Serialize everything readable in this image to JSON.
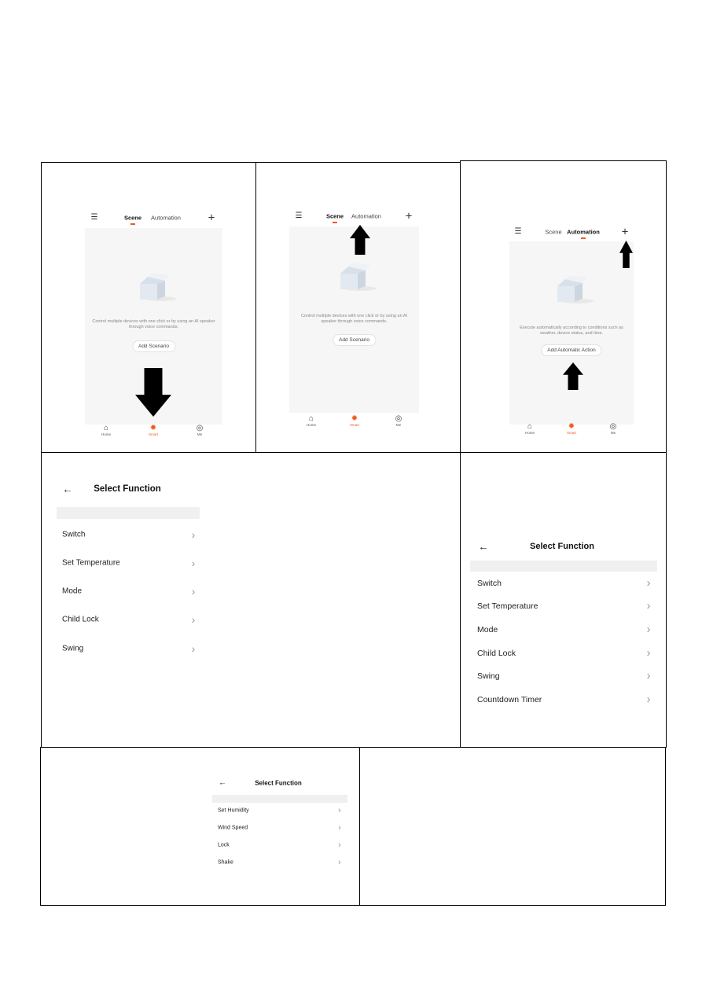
{
  "phones": [
    {
      "nav": {
        "menu_icon": "hamburger-icon",
        "tabs": [
          "Scene",
          "Automation"
        ],
        "active": 0,
        "add_icon": "plus-icon"
      },
      "description": "Control multiple devices with one click or by using an AI speaker through voice commands.",
      "button": "Add Scenario",
      "bottom_tabs": [
        "Home",
        "Smart",
        "Me"
      ],
      "active_bottom": 1
    },
    {
      "nav": {
        "menu_icon": "hamburger-icon",
        "tabs": [
          "Scene",
          "Automation"
        ],
        "active": 0,
        "add_icon": "plus-icon"
      },
      "description": "Control multiple devices with one click or by using an AI speaker through voice commands.",
      "button": "Add Scenario",
      "bottom_tabs": [
        "Home",
        "Smart",
        "Me"
      ],
      "active_bottom": 1
    },
    {
      "nav": {
        "menu_icon": "hamburger-icon",
        "tabs": [
          "Scene",
          "Automation"
        ],
        "active": 1,
        "add_icon": "plus-icon"
      },
      "description": "Execute automatically according to conditions such as weather, device status, and time.",
      "button": "Add Automatic Action",
      "bottom_tabs": [
        "Home",
        "Smart",
        "Me"
      ],
      "active_bottom": 1
    }
  ],
  "select_function": [
    {
      "title": "Select Function",
      "items": [
        "Switch",
        "Set Temperature",
        "Mode",
        "Child Lock",
        "Swing"
      ]
    },
    {
      "title": "Select Function",
      "items": [
        "Switch",
        "Set Temperature",
        "Mode",
        "Child Lock",
        "Swing",
        "Countdown Timer"
      ]
    },
    {
      "title": "Select Function",
      "items": [
        "Set Humidity",
        "Wind Speed",
        "Lock",
        "Shake"
      ]
    }
  ],
  "colors": {
    "accent": "#f05a1e",
    "panel": "#f6f6f6"
  }
}
